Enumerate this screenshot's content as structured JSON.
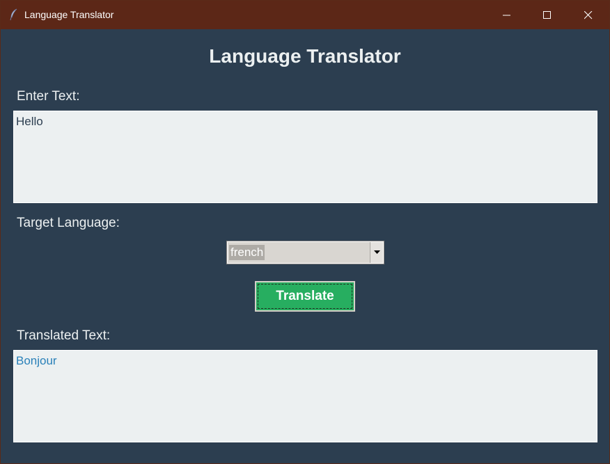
{
  "window": {
    "title": "Language Translator",
    "controls": {
      "minimize_icon": "minimize-icon",
      "maximize_icon": "maximize-icon",
      "close_icon": "close-icon"
    },
    "titlebar_color": "#5c2717"
  },
  "app": {
    "heading": "Language Translator",
    "background_color": "#2c3e50",
    "input": {
      "label": "Enter Text:",
      "value": "Hello"
    },
    "target_language": {
      "label": "Target Language:",
      "selected": "french"
    },
    "translate_button": {
      "label": "Translate",
      "color": "#27ae60"
    },
    "output": {
      "label": "Translated Text:",
      "value": "Bonjour",
      "text_color": "#2980b9"
    }
  }
}
